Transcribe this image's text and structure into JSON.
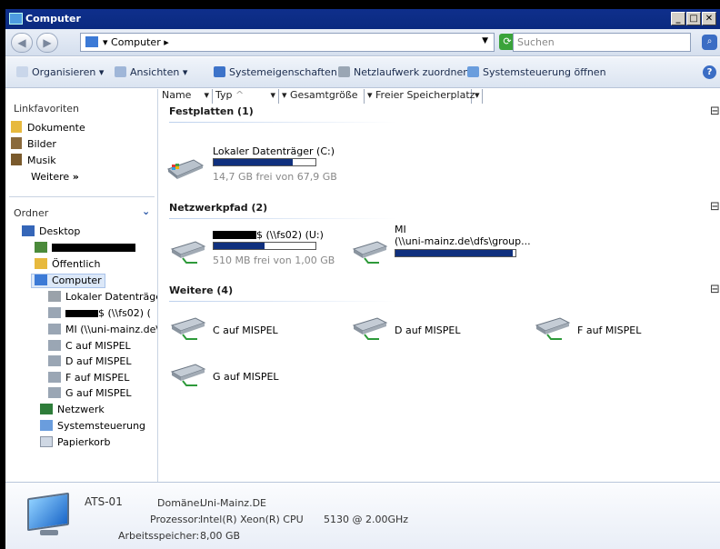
{
  "window": {
    "title": "Computer"
  },
  "address": {
    "path": "Computer",
    "search_placeholder": "Suchen"
  },
  "toolbar": {
    "organize": "Organisieren",
    "views": "Ansichten",
    "properties": "Systemeigenschaften",
    "map_drive": "Netzlaufwerk zuordnen",
    "control_panel": "Systemsteuerung öffnen"
  },
  "favorites": {
    "header": "Linkfavoriten",
    "items": [
      "Dokumente",
      "Bilder",
      "Musik"
    ],
    "more": "Weitere"
  },
  "tree": {
    "header": "Ordner",
    "desktop": "Desktop",
    "public": "Öffentlich",
    "computer": "Computer",
    "local_disk": "Lokaler Datenträger",
    "share_fs02": "$ (\\\\fs02) (",
    "mi_share": "MI (\\\\uni-mainz.de\\c",
    "c_mispel": "C auf MISPEL",
    "d_mispel": "D auf MISPEL",
    "f_mispel": "F auf MISPEL",
    "g_mispel": "G auf MISPEL",
    "network": "Netzwerk",
    "control_panel": "Systemsteuerung",
    "recycle": "Papierkorb"
  },
  "columns": [
    "Name",
    "Typ",
    "Gesamtgröße",
    "Freier Speicherplatz"
  ],
  "groups": {
    "hard_disks": "Festplatten (1)",
    "network": "Netzwerkpfad (2)",
    "other": "Weitere (4)"
  },
  "drives": {
    "local": {
      "label": "Lokaler Datenträger (C:)",
      "free": "14,7 GB frei von 67,9 GB",
      "used_fraction": 0.78
    },
    "fs02": {
      "label": "$ (\\\\fs02) (U:)",
      "free": "510 MB frei von 1,00 GB",
      "used_fraction": 0.5
    },
    "mi": {
      "label1": "MI",
      "label2": "(\\\\uni-mainz.de\\dfs\\group...",
      "used_fraction": 0.98
    }
  },
  "other_items": [
    "C auf MISPEL",
    "D auf MISPEL",
    "F auf MISPEL",
    "G auf MISPEL"
  ],
  "details": {
    "name": "ATS-01",
    "domain_label": "Domäne:",
    "domain": "Uni-Mainz.DE",
    "cpu_label": "Prozessor:",
    "cpu": "Intel(R) Xeon(R) CPU",
    "cpu_speed": "5130 @ 2.00GHz",
    "mem_label": "Arbeitsspeicher:",
    "mem": "8,00 GB"
  },
  "colors": {
    "bar_fill": "#10307e",
    "title_bar": "#0f2f8c"
  }
}
